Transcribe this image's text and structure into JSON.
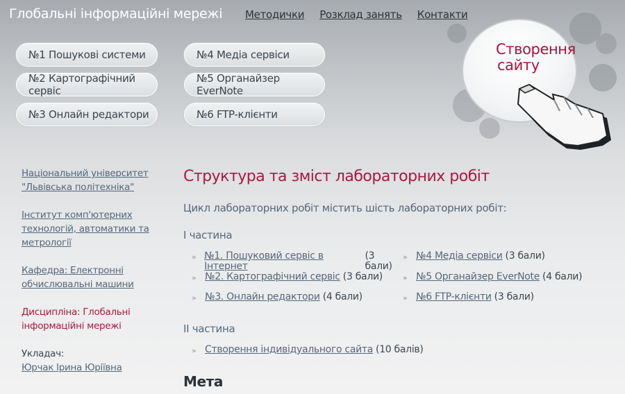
{
  "header": {
    "site_title": "Глобальні інформаційні мережі",
    "nav": [
      "Методички",
      "Розклад занять",
      "Контакти"
    ]
  },
  "lab_pills": [
    "№1 Пошукові системи",
    "№2 Картографічний сервіс",
    "№3 Онлайн редактори",
    "№4 Медіа сервіси",
    "№5 Органайзер EverNote",
    "№6 FTP-клієнти"
  ],
  "promo": {
    "line1": "Створення",
    "line2": "сайту",
    "icon": "pointing-hand-cursor-icon"
  },
  "sidebar": {
    "university": "Національний університет \"Львівська політехніка\"",
    "institute": "Інститут комп'ютерних технологій, автоматики та метрології",
    "department": "Кафедра: Електронні обчислювальні машини",
    "discipline": "Дисципліна: Глобальні інформаційні мережі",
    "author_label": "Укладач:",
    "author_name": "Юрчак Ірина Юріївна"
  },
  "main": {
    "title": "Структура та зміст лабораторних робіт",
    "intro": "Цикл лабораторних робіт містить шість лабораторних робіт:",
    "part1_title": "І частина",
    "part1_left": [
      {
        "link": "№1. Пошуковий сервіс в Інтернет",
        "score": "(3 бали)"
      },
      {
        "link": "№2. Картографічний сервіс",
        "score": "(3 бали)"
      },
      {
        "link": "№3. Онлайн редактори",
        "score": "(4 бали)"
      }
    ],
    "part1_right": [
      {
        "link": "№4 Медіа сервіси",
        "score": "(3 бали)"
      },
      {
        "link": "№5 Органайзер EverNote",
        "score": "(4 бали)"
      },
      {
        "link": "№6 FTP-клієнти",
        "score": "(3 бали)"
      }
    ],
    "part2_title": "ІІ частина",
    "part2_items": [
      {
        "link": "Створення індивідуального сайта",
        "score": "(10 балів)"
      }
    ],
    "goal_title": "Мета"
  },
  "bullet": "»"
}
